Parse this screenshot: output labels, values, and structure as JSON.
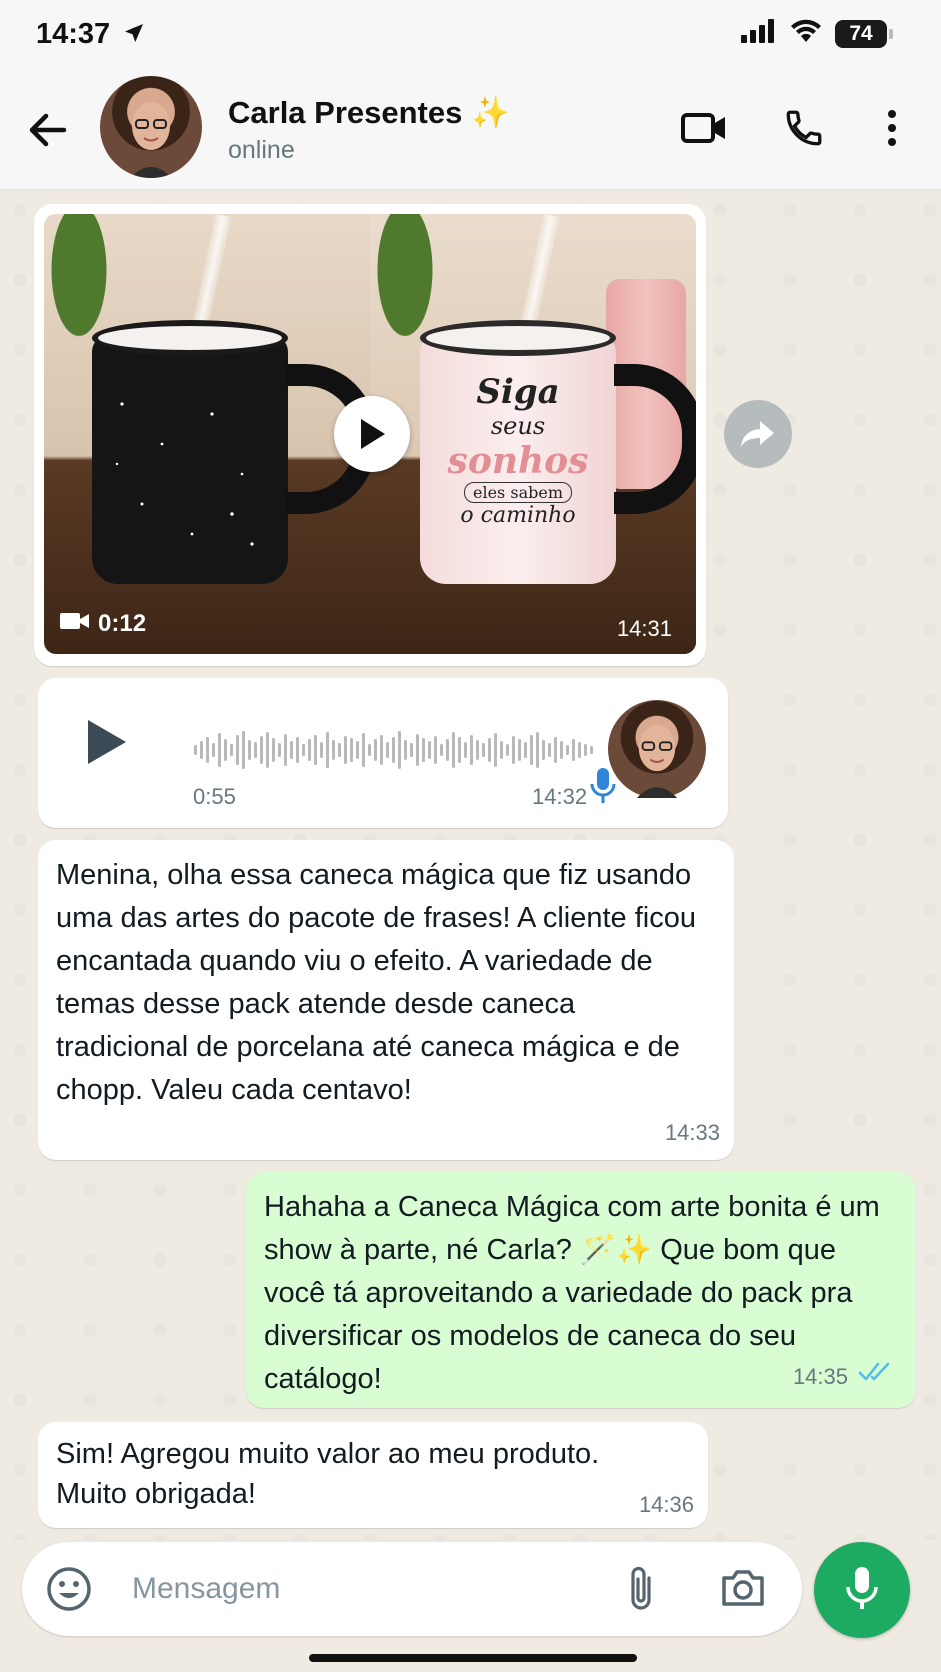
{
  "status_bar": {
    "time": "14:37",
    "battery": "74"
  },
  "header": {
    "contact_name": "Carla Presentes ✨",
    "contact_status": "online"
  },
  "messages": {
    "video": {
      "duration": "0:12",
      "time": "14:31",
      "mug_text": {
        "line1": "Siga",
        "line2": "seus",
        "line3": "sonhos",
        "line4": "eles sabem",
        "line5": "o caminho"
      }
    },
    "audio": {
      "duration": "0:55",
      "time": "14:32"
    },
    "text_in_1": {
      "text": "Menina, olha essa caneca mágica que fiz usando uma das artes do pacote de frases! A cliente ficou encantada quando viu o efeito. A variedade de temas desse pack atende desde caneca tradicional de porcelana até caneca mágica e de chopp. Valeu cada centavo!",
      "time": "14:33"
    },
    "text_out_1": {
      "text": "Hahaha a Caneca Mágica com arte bonita é um show à parte, né Carla? 🪄✨ Que bom que você tá aproveitando a variedade do pack pra diversificar os modelos de caneca do seu catálogo!",
      "time": "14:35",
      "status": "read"
    },
    "text_in_2": {
      "text": "Sim! Agregou muito valor ao meu produto. Muito obrigada!",
      "time": "14:36"
    }
  },
  "composer": {
    "placeholder": "Mensagem",
    "value": ""
  },
  "colors": {
    "accent": "#1daa61",
    "outgoing_bubble": "#d9fdd3",
    "read_tick": "#53bdeb",
    "chat_bg": "#efeae2"
  }
}
